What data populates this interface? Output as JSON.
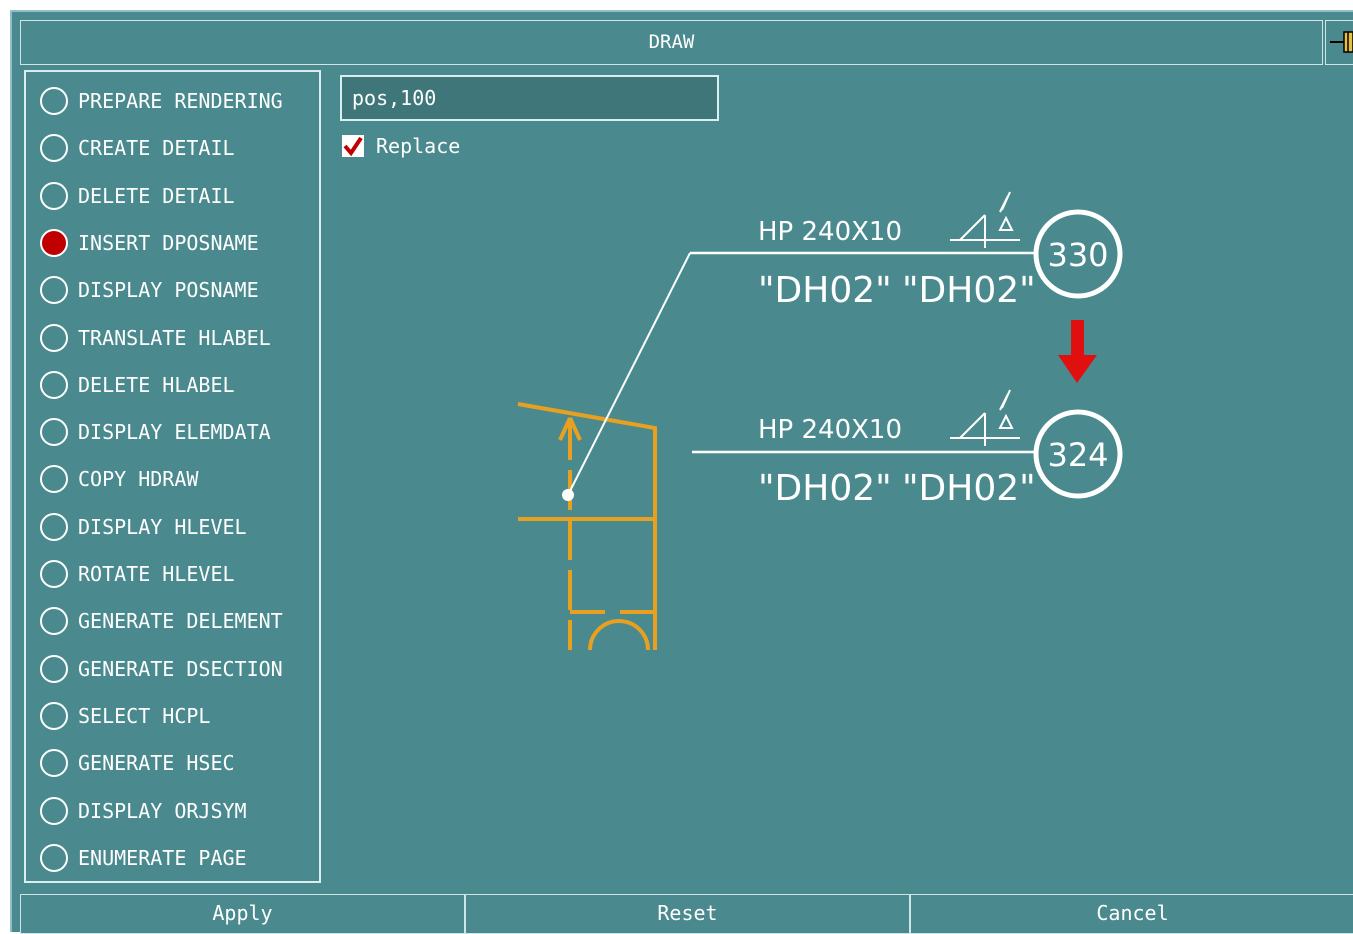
{
  "window": {
    "title": "DRAW"
  },
  "options": [
    {
      "label": "PREPARE RENDERING",
      "selected": false
    },
    {
      "label": "CREATE DETAIL",
      "selected": false
    },
    {
      "label": "DELETE DETAIL",
      "selected": false
    },
    {
      "label": "INSERT DPOSNAME",
      "selected": true
    },
    {
      "label": "DISPLAY POSNAME",
      "selected": false
    },
    {
      "label": "TRANSLATE HLABEL",
      "selected": false
    },
    {
      "label": "DELETE HLABEL",
      "selected": false
    },
    {
      "label": "DISPLAY ELEMDATA",
      "selected": false
    },
    {
      "label": "COPY HDRAW",
      "selected": false
    },
    {
      "label": "DISPLAY HLEVEL",
      "selected": false
    },
    {
      "label": "ROTATE HLEVEL",
      "selected": false
    },
    {
      "label": "GENERATE DELEMENT",
      "selected": false
    },
    {
      "label": "GENERATE DSECTION",
      "selected": false
    },
    {
      "label": "SELECT HCPL",
      "selected": false
    },
    {
      "label": "GENERATE HSEC",
      "selected": false
    },
    {
      "label": "DISPLAY ORJSYM",
      "selected": false
    },
    {
      "label": "ENUMERATE PAGE",
      "selected": false
    }
  ],
  "input": {
    "value": "pos,100"
  },
  "replace": {
    "label": "Replace",
    "checked": true
  },
  "drawing": {
    "upper": {
      "profile": "HP 240X10",
      "tag1": "\"DH02\"",
      "tag2": "\"DH02\"",
      "number": "330"
    },
    "lower": {
      "profile": "HP 240X10",
      "tag1": "\"DH02\"",
      "tag2": "\"DH02\"",
      "number": "324"
    },
    "colors": {
      "structure": "#e8a020",
      "arrow": "#e01010",
      "annotation": "#ffffff"
    }
  },
  "buttons": {
    "apply": "Apply",
    "reset": "Reset",
    "cancel": "Cancel"
  }
}
